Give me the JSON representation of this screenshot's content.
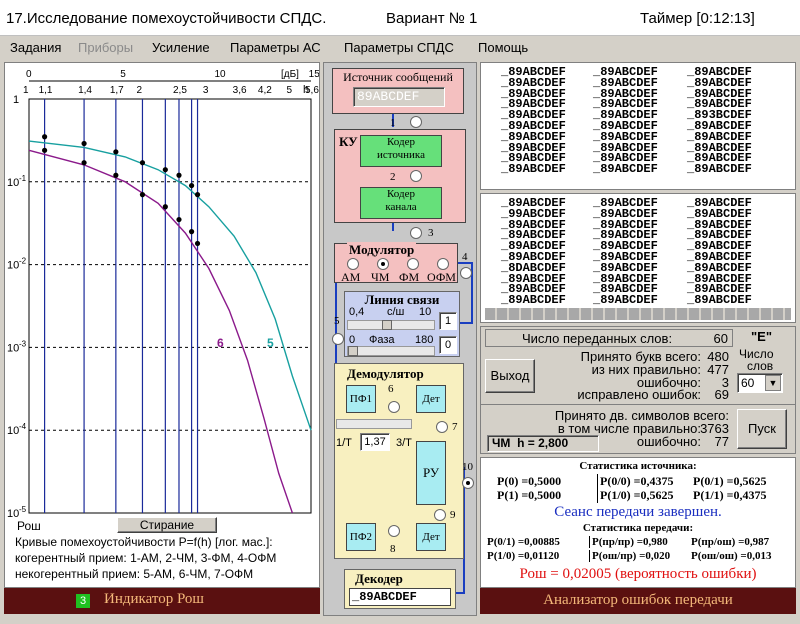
{
  "title": {
    "main": "17.Исследование помехоустойчивости СПДС.",
    "variant": "Вариант № 1",
    "timer": "Таймер [0:12:13]"
  },
  "menu": [
    "Задания",
    "Приборы",
    "Усиление",
    "Параметры АС",
    "Параметры СПДС",
    "Помощь"
  ],
  "chart_data": {
    "type": "line",
    "title": "Кривые помехоустойчивости P=f(h) [лог. мас.]:",
    "xlabel": "h",
    "x_unit": "[дБ]",
    "ylabel": "Рош",
    "yscale": "log",
    "ylim": [
      1e-05,
      1
    ],
    "db_ticks": [
      "0",
      "5",
      "10",
      "15"
    ],
    "h_ticks": [
      "1",
      "1,1",
      "1,4",
      "1,7",
      "2",
      "2,5",
      "3",
      "3,6",
      "4,2",
      "5",
      "5,6"
    ],
    "y_ticks": [
      "1",
      "10-1",
      "10-2",
      "10-3",
      "10-4",
      "10-5"
    ],
    "series": [
      {
        "name": "5",
        "color": "#18a0a0",
        "x": [
          1,
          1.4,
          1.8,
          2.2,
          2.6,
          3,
          3.5,
          4,
          4.5,
          5,
          5.6
        ],
        "values": [
          0.31,
          0.26,
          0.2,
          0.14,
          0.09,
          0.05,
          0.022,
          0.008,
          0.0022,
          0.00045,
          0.0001
        ]
      },
      {
        "name": "6",
        "color": "#8b1a8b",
        "x": [
          1,
          1.4,
          1.8,
          2.2,
          2.6,
          3,
          3.4,
          3.8,
          4.2,
          4.6,
          5
        ],
        "values": [
          0.24,
          0.16,
          0.1,
          0.055,
          0.024,
          0.009,
          0.0028,
          0.0007,
          0.00014,
          3e-05,
          1e-05
        ]
      }
    ],
    "points": [
      [
        1.1,
        0.35
      ],
      [
        1.1,
        0.24
      ],
      [
        1.4,
        0.29
      ],
      [
        1.4,
        0.17
      ],
      [
        1.7,
        0.23
      ],
      [
        1.7,
        0.12
      ],
      [
        2,
        0.17
      ],
      [
        2,
        0.07
      ],
      [
        2.3,
        0.14
      ],
      [
        2.3,
        0.05
      ],
      [
        2.5,
        0.12
      ],
      [
        2.5,
        0.035
      ],
      [
        2.7,
        0.09
      ],
      [
        2.7,
        0.025
      ],
      [
        2.8,
        0.07
      ],
      [
        2.8,
        0.018
      ]
    ]
  },
  "plot": {
    "y_axis_label": "Рош",
    "clear_button": "Стирание",
    "caption": "Кривые помехоустойчивости P=f(h) [лог. мас.]:",
    "coherent": "когерентный прием: 1-АМ, 2-ЧМ, 3-ФМ, 4-ОФМ",
    "noncoherent": "некогерентный прием: 5-АМ, 6-ЧМ, 7-ОФМ",
    "curve5": "5",
    "curve6": "6",
    "footer_num": "3",
    "footer": "Индикатор Рош"
  },
  "scheme": {
    "source_label": "Источник сообщений",
    "source_value": "89ABCDEF",
    "ku": "КУ",
    "coder_src": [
      "Кодер",
      "источника"
    ],
    "coder_ch": [
      "Кодер",
      "канала"
    ],
    "modulator": "Модулятор",
    "mods": [
      "АМ",
      "ЧМ",
      "ФМ",
      "ОФМ"
    ],
    "line": "Линия связи",
    "sn_left": "0,4",
    "sn_label": "с/ш",
    "sn_right": "10",
    "sn_value": "1",
    "ph_left": "0",
    "ph_label": "Фаза",
    "ph_right": "180",
    "ph_value": "0",
    "demod": "Демодулятор",
    "pf1": "ПФ1",
    "pf2": "ПФ2",
    "det1": "Дет",
    "det2": "Дет",
    "ru": "РУ",
    "t_left": "1/T",
    "t_value": "1,37",
    "t_right": "3/T",
    "decoder": "Декодер",
    "decoder_value": "_89ABCDEF",
    "points": [
      "1",
      "2",
      "3",
      "4",
      "5",
      "6",
      "7",
      "8",
      "9",
      "10"
    ]
  },
  "analyzer": {
    "top_codes": [
      [
        "_89ABCDEF",
        "_89ABCDEF",
        "_89ABCDEF",
        "_89ABCDEF",
        "_89ABCDEF",
        "_89ABCDEF",
        "_89ABCDEF",
        "_89ABCDEF",
        "_89ABCDEF",
        "_89ABCDEF"
      ],
      [
        "_89ABCDEF",
        "_89ABCDEF",
        "_89ABCDEF",
        "_89ABCDEF",
        "_89ABCDEF",
        "_89ABCDEF",
        "_89ABCDEF",
        "_89ABCDEF",
        "_89ABCDEF",
        "_89ABCDEF"
      ],
      [
        "_89ABCDEF",
        "_89ABCDEF",
        "_89ABCDEF",
        "_89ABCDEF",
        "_893BCDEF",
        "_89ABCDEF",
        "_89ABCDEF",
        "_89ABCDEF",
        "_89ABCDEF",
        "_89ABCDEF"
      ]
    ],
    "bottom_codes": [
      [
        "_89ABCDEF",
        "_99ABCDEF",
        "_89ABCDEF",
        "_89ABCDEF",
        "_89ABCDEF",
        "_89ABCDEF",
        "_8DABCDEF",
        "_89ABCDEF",
        "_89ABCDEF",
        "_89ABCDEF"
      ],
      [
        "_89ABCDEF",
        "_89ABCDEF",
        "_89ABCDEF",
        "_89ABCDEF",
        "_89ABCDEF",
        "_89ABCDEF",
        "_89ABCDEF",
        "_89ABCDEF",
        "_89ABCDEF",
        "_89ABCDEF"
      ],
      [
        "_89ABCDEF",
        "_89ABCDEF",
        "_89ABCDEF",
        "_89ABCDEF",
        "_89ABCDEF",
        "_89ABCDEF",
        "_89ABCDEF",
        "_89ABCDEF",
        "_89ABCDEF",
        "_89ABCDEF"
      ]
    ],
    "words_sent_label": "Число переданных слов:",
    "words_sent": "60",
    "e_label": "\"E\"",
    "words_count_label1": "Число",
    "words_count_label2": "слов",
    "words_count_value": "60",
    "letters_label": "Принято букв всего:",
    "letters": "480",
    "correct_label": "из них правильно:",
    "correct": "477",
    "wrong_label": "ошибочно:",
    "wrong": "3",
    "fixed_label": "исправлено ошибок:",
    "fixed": "69",
    "exit_button": "Выход",
    "start_button": "Пуск",
    "bin_label": "Принято дв. символов всего:",
    "bin": "3840",
    "bin_correct_label": "в том числе правильно:",
    "bin_correct": "3763",
    "bin_wrong_label": "ошибочно:",
    "bin_wrong": "77",
    "mode": "ЧМ  h = 2,800",
    "src_stat_title": "Статистика источника:",
    "p0": "P(0) =0,5000",
    "p1": "P(1) =0,5000",
    "p00": "P(0/0) =0,4375",
    "p10": "P(1/0) =0,5625",
    "p01": "P(0/1) =0,5625",
    "p11": "P(1/1) =0,4375",
    "session": "Сеанс передачи завершен.",
    "tx_stat_title": "Статистика передачи:",
    "q01": "P(0/1) =0,00885",
    "q10": "P(1/0) =0,01120",
    "qpp": "P(пр/пр) =0,980",
    "qop": "P(ош/пр) =0,020",
    "qpo": "P(пр/ош) =0,987",
    "qoo": "P(ош/ош) =0,013",
    "perr": "Рош = 0,02005 (вероятность ошибки)",
    "footer": "Анализатор ошибок передачи"
  }
}
